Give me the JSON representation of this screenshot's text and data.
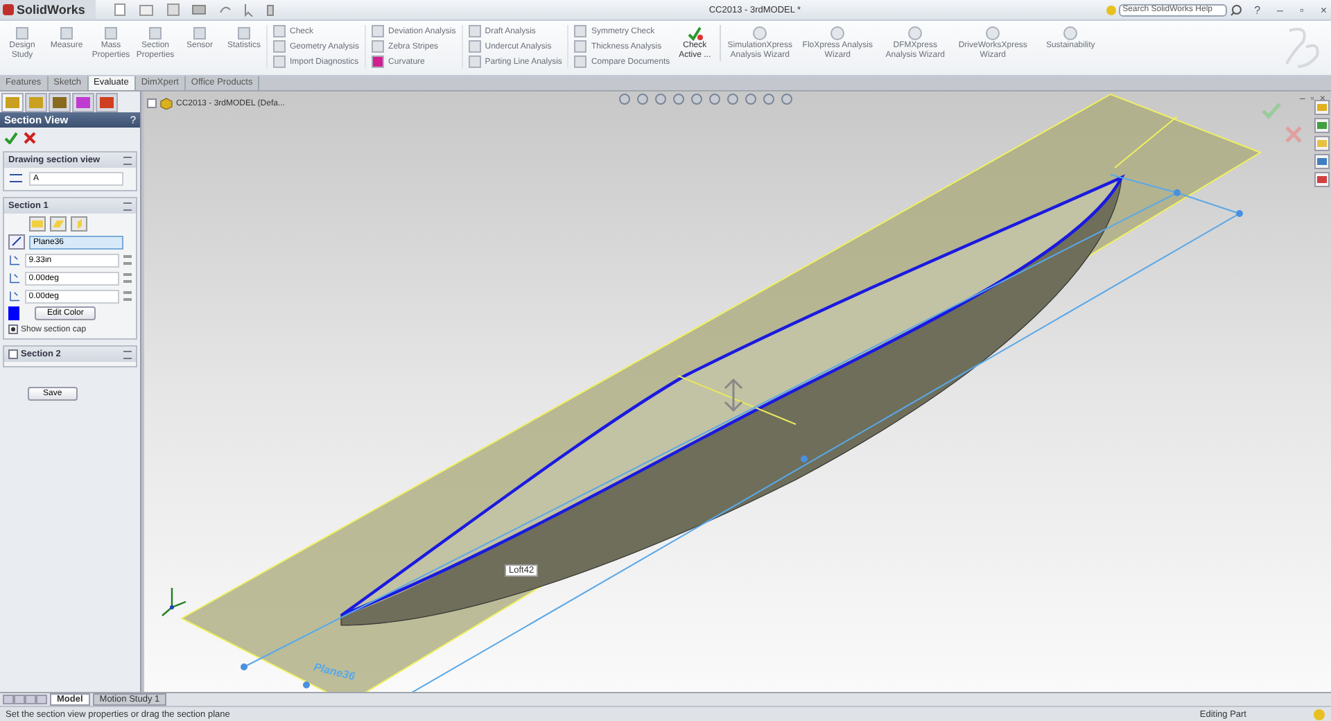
{
  "app": {
    "logo": "SolidWorks",
    "title": "CC2013 - 3rdMODEL *",
    "search": {
      "placeholder": "Search SolidWorks Help"
    },
    "help": "?",
    "window_controls": [
      "–",
      "▫",
      "×"
    ]
  },
  "ribbon": {
    "large_tools": [
      {
        "label": "Design Study"
      },
      {
        "label": "Measure"
      },
      {
        "label": "Mass Properties"
      },
      {
        "label": "Section Properties"
      },
      {
        "label": "Sensor"
      },
      {
        "label": "Statistics"
      }
    ],
    "small_groups": [
      [
        "Check",
        "Geometry Analysis",
        "Import Diagnostics"
      ],
      [
        "Deviation Analysis",
        "Zebra Stripes",
        "Curvature"
      ],
      [
        "Draft Analysis",
        "Undercut Analysis",
        "Parting Line Analysis"
      ],
      [
        "Symmetry Check",
        "Thickness Analysis",
        "Compare Documents"
      ]
    ],
    "check_active": "Check Active ...",
    "wizards": [
      {
        "label": "SimulationXpress Analysis Wizard"
      },
      {
        "label": "FloXpress Analysis Wizard"
      },
      {
        "label": "DFMXpress Analysis Wizard"
      },
      {
        "label": "DriveWorksXpress Wizard"
      },
      {
        "label": "Sustainability"
      }
    ]
  },
  "tabs": [
    {
      "label": "Features",
      "selected": false
    },
    {
      "label": "Sketch",
      "selected": false
    },
    {
      "label": "Evaluate",
      "selected": true
    },
    {
      "label": "DimXpert",
      "selected": false
    },
    {
      "label": "Office Products",
      "selected": false
    }
  ],
  "property_manager": {
    "title": "Section View",
    "help": "?",
    "drawing_section_view": {
      "title": "Drawing section view",
      "name": "A"
    },
    "section_1": {
      "title": "Section 1",
      "plane": "Plane36",
      "fields": [
        "9.33in",
        "0.00deg",
        "0.00deg"
      ],
      "color": "#0000ff",
      "edit_color": "Edit Color",
      "show_section_cap": {
        "label": "Show section cap",
        "checked": true
      }
    },
    "section_2": {
      "title": "Section 2",
      "checked": false
    },
    "save": "Save"
  },
  "viewport": {
    "tree_root": "CC2013 - 3rdMODEL  (Defa...",
    "callout": "Loft42",
    "plane_label": "Plane36",
    "window_controls": [
      "–",
      "▫",
      "×"
    ]
  },
  "bottom_tabs": [
    {
      "label": "Model",
      "selected": true
    },
    {
      "label": "Motion Study 1",
      "selected": false
    }
  ],
  "status_bar": {
    "message": "Set the section view properties or drag the section plane",
    "mode": "Editing Part"
  }
}
